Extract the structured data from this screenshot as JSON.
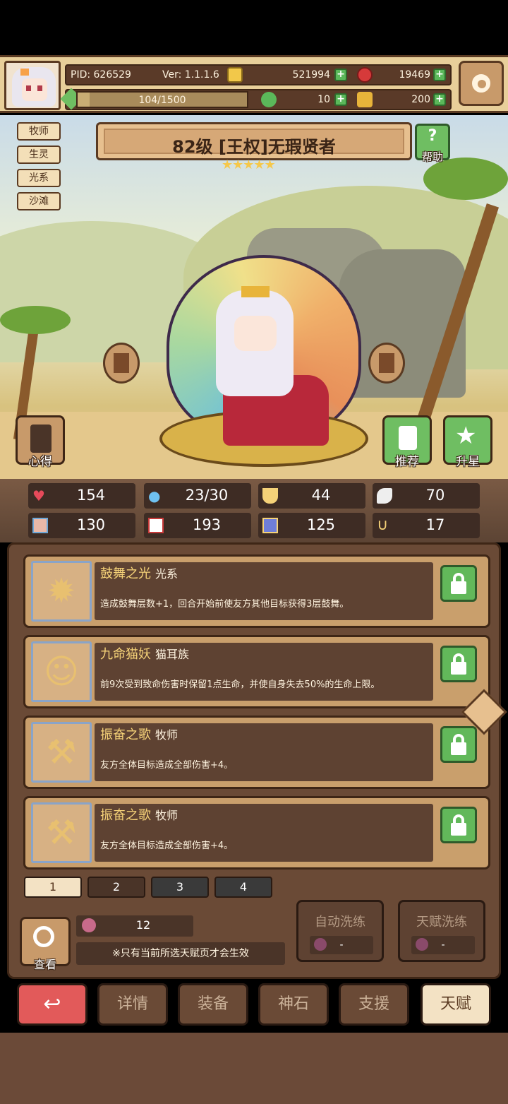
{
  "header": {
    "pid": "PID: 626529",
    "version": "Ver: 1.1.1.6",
    "gold": "521994",
    "gems": "19469",
    "xp": "104/1500",
    "xp_progress": 0.069,
    "clover": "10",
    "key": "200"
  },
  "hero": {
    "tags": [
      "牧师",
      "生灵",
      "光系",
      "沙滩"
    ],
    "title": "82级 [王权]无瑕贤者",
    "stars": "★★★★★",
    "help_label": "帮助",
    "left_btn_label": "心得",
    "recommend_label": "推荐",
    "upgrade_label": "升星"
  },
  "stats": {
    "hp": "154",
    "mana": "23/30",
    "defense": "44",
    "speed": "70",
    "attack": "130",
    "magic": "193",
    "crit": "125",
    "luck": "17"
  },
  "talents": [
    {
      "name": "鼓舞之光",
      "tag": "光系",
      "desc": "造成鼓舞层数+1，回合开始前使友方其他目标获得3层鼓舞。"
    },
    {
      "name": "九命猫妖",
      "tag": "猫耳族",
      "desc": "前9次受到致命伤害时保留1点生命，并使自身失去50%的生命上限。"
    },
    {
      "name": "振奋之歌",
      "tag": "牧师",
      "desc": "友方全体目标造成全部伤害+4。"
    },
    {
      "name": "振奋之歌",
      "tag": "牧师",
      "desc": "友方全体目标造成全部伤害+4。"
    }
  ],
  "pages": [
    "1",
    "2",
    "3",
    "4"
  ],
  "controls": {
    "view_label": "查看",
    "count": "12",
    "note": "※只有当前所选天赋页才会生效",
    "auto_wash": "自动洗练",
    "talent_wash": "天赋洗练",
    "auto_cost": "-",
    "talent_cost": "-"
  },
  "nav": {
    "details": "详情",
    "equip": "装备",
    "stone": "神石",
    "support": "支援",
    "talent": "天赋"
  },
  "colors": {
    "accent_green": "#62b85a",
    "panel_brown": "#6a4a36",
    "gold_text": "#f5d278"
  }
}
